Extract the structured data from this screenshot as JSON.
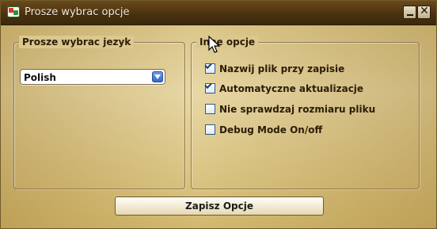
{
  "window": {
    "title": "Prosze wybrac opcje",
    "app_icon": "app-icon",
    "controls": {
      "minimize_icon": "minimize-icon",
      "close_icon": "close-icon",
      "close_glyph": "✕"
    }
  },
  "language_group": {
    "legend": "Prosze wybrac jezyk",
    "language_select": {
      "selected": "Polish"
    }
  },
  "options_group": {
    "legend": "Inne opcje",
    "options": [
      {
        "label": "Nazwij plik przy zapisie",
        "checked": true
      },
      {
        "label": "Automatyczne aktualizacje",
        "checked": true
      },
      {
        "label": "Nie sprawdzaj rozmiaru pliku",
        "checked": false
      },
      {
        "label": "Debug Mode On/off",
        "checked": false
      }
    ]
  },
  "footer": {
    "save_button": "Zapisz Opcje"
  },
  "theme": {
    "accent": "#4a3210",
    "panel": "#e0cf98",
    "text": "#2a1d08"
  }
}
